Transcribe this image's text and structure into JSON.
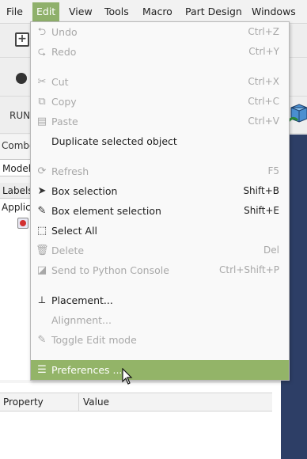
{
  "menubar": {
    "items": [
      {
        "label": "File"
      },
      {
        "label": "Edit"
      },
      {
        "label": "View"
      },
      {
        "label": "Tools"
      },
      {
        "label": "Macro"
      },
      {
        "label": "Part Design"
      },
      {
        "label": "Windows"
      }
    ]
  },
  "background": {
    "run_label": "RUN",
    "combo_tab": "Combo",
    "model_tab": "Model",
    "labels_header": "Labels",
    "tree_item": "Applica",
    "property_header": {
      "property": "Property",
      "value": "Value"
    }
  },
  "edit_menu": {
    "items": [
      {
        "label": "Undo",
        "shortcut": "Ctrl+Z",
        "icon": "undo-icon",
        "enabled": false
      },
      {
        "label": "Redo",
        "shortcut": "Ctrl+Y",
        "icon": "redo-icon",
        "enabled": false
      },
      {
        "label": "Cut",
        "shortcut": "Ctrl+X",
        "icon": "cut-icon",
        "enabled": false
      },
      {
        "label": "Copy",
        "shortcut": "Ctrl+C",
        "icon": "copy-icon",
        "enabled": false
      },
      {
        "label": "Paste",
        "shortcut": "Ctrl+V",
        "icon": "paste-icon",
        "enabled": false
      },
      {
        "label": "Duplicate selected object",
        "shortcut": "",
        "icon": "",
        "enabled": true
      },
      {
        "label": "Refresh",
        "shortcut": "F5",
        "icon": "refresh-icon",
        "enabled": false
      },
      {
        "label": "Box selection",
        "shortcut": "Shift+B",
        "icon": "pointer-icon",
        "enabled": true
      },
      {
        "label": "Box element selection",
        "shortcut": "Shift+E",
        "icon": "pencil-icon",
        "enabled": true
      },
      {
        "label": "Select All",
        "shortcut": "",
        "icon": "select-all-icon",
        "enabled": true
      },
      {
        "label": "Delete",
        "shortcut": "Del",
        "icon": "trash-icon",
        "enabled": false
      },
      {
        "label": "Send to Python Console",
        "shortcut": "Ctrl+Shift+P",
        "icon": "python-icon",
        "enabled": false
      },
      {
        "label": "Placement...",
        "shortcut": "",
        "icon": "axes-icon",
        "enabled": true
      },
      {
        "label": "Alignment...",
        "shortcut": "",
        "icon": "",
        "enabled": false
      },
      {
        "label": "Toggle Edit mode",
        "shortcut": "",
        "icon": "edit-pencil-icon",
        "enabled": false
      },
      {
        "label": "Preferences ...",
        "shortcut": "",
        "icon": "preferences-icon",
        "enabled": true
      }
    ]
  },
  "colors": {
    "accent": "#93b468",
    "viewport": "#2d3e66"
  }
}
